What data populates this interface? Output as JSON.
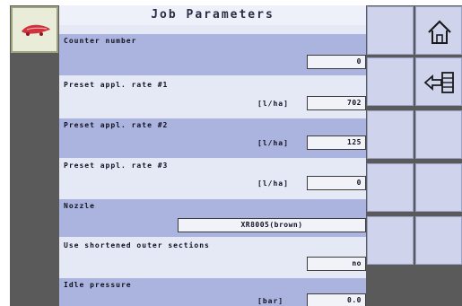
{
  "header": {
    "title": "Job Parameters"
  },
  "rows": {
    "counter": {
      "label": "Counter number",
      "value": "0"
    },
    "rate1": {
      "label": "Preset appl. rate #1",
      "unit": "[l/ha]",
      "value": "702"
    },
    "rate2": {
      "label": "Preset appl. rate #2",
      "unit": "[l/ha]",
      "value": "125"
    },
    "rate3": {
      "label": "Preset appl. rate #3",
      "unit": "[l/ha]",
      "value": "0"
    },
    "nozzle": {
      "label": "Nozzle",
      "value": "XR8005(brown)"
    },
    "sections": {
      "label": "Use shortened outer sections",
      "value": "no"
    },
    "idle": {
      "label": "Idle pressure",
      "unit": "[bar]",
      "value": "0.0"
    }
  },
  "icons": {
    "logo": "sprayer-logo-icon",
    "home": "home-icon",
    "back": "back-arrow-icon"
  },
  "colors": {
    "row_dark": "#aab4de",
    "row_light": "#e5e8f5",
    "button": "#cfd4ec",
    "frame": "#5a5a5a",
    "logo_red": "#d2323c"
  }
}
